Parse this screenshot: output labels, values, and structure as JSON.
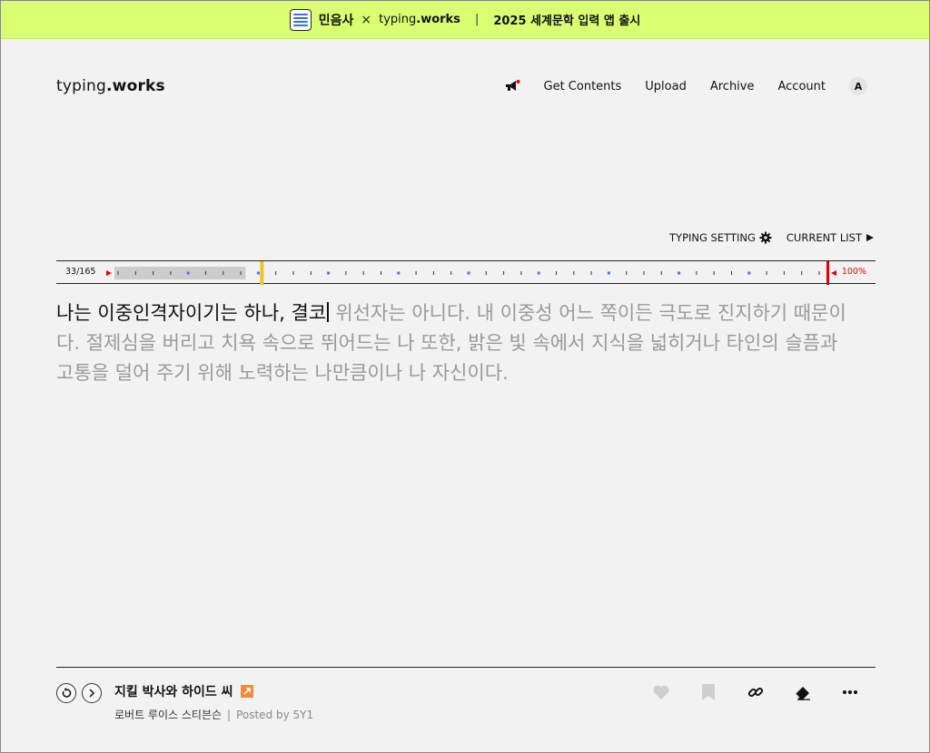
{
  "banner": {
    "partner_name": "민음사",
    "times": "×",
    "brand_prefix": "typing",
    "brand_suffix": ".works",
    "separator": "|",
    "promo_text": "2025 세계문학 입력 앱 출시"
  },
  "header": {
    "logo_prefix": "typing",
    "logo_suffix": ".works",
    "nav": {
      "get_contents": "Get Contents",
      "upload": "Upload",
      "archive": "Archive",
      "account": "Account",
      "avatar_letter": "A"
    }
  },
  "toolbar": {
    "typing_setting": "TYPING SETTING",
    "current_list": "CURRENT LIST"
  },
  "progress": {
    "count": "33/165",
    "percent_label": "100%",
    "current_fraction": 0.2,
    "typed_fraction": 0.2
  },
  "typing": {
    "typed_text": "나는 이중인격자이기는 하나, 결코",
    "remaining_text": " 위선자는 아니다. 내 이중성 어느 쪽이든 극도로 진지하기 때문이다. 절제심을 버리고 치욕 속으로 뛰어드는 나 또한, 밝은 빛 속에서 지식을 넓히거나 타인의 슬픔과 고통을 덜어 주기 위해 노력하는 나만큼이나 나 자신이다."
  },
  "footer": {
    "book_title": "지킬 박사와 하이드 씨",
    "author": "로버트 루이스 스티븐슨",
    "meta_separator": "|",
    "posted_by": "Posted by 5Y1"
  },
  "colors": {
    "banner_bg": "#d9ff72",
    "accent_red": "#e00000",
    "marker_yellow": "#f3c21b",
    "tick_blue": "#4a6cf7",
    "ext_orange": "#f08c3a"
  },
  "icons": [
    "megaphone-icon",
    "gear-icon",
    "play-triangle-icon",
    "restart-icon",
    "chevron-right-icon",
    "external-link-icon",
    "heart-icon",
    "bookmark-icon",
    "link-icon",
    "eraser-icon",
    "more-icon"
  ]
}
